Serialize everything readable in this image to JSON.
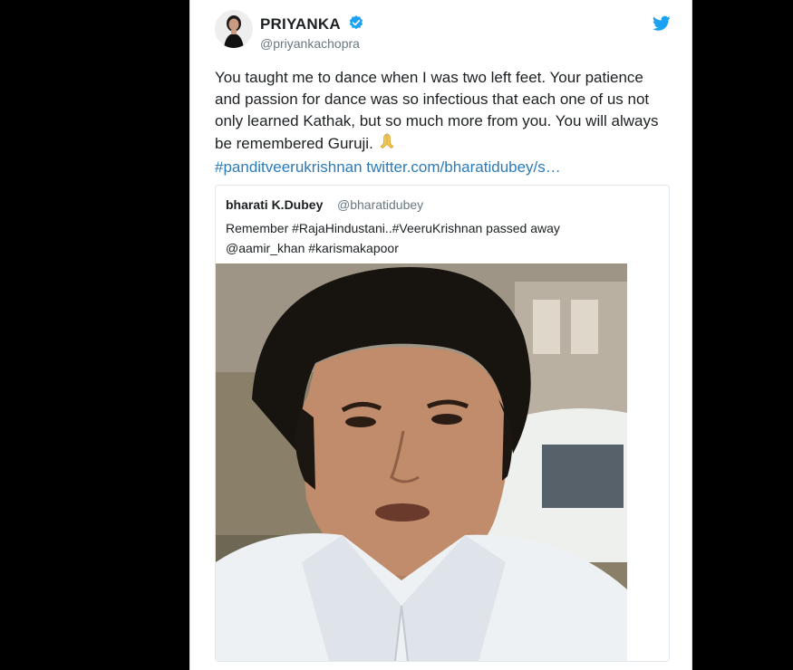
{
  "tweet": {
    "author_name": "PRIYANKA",
    "author_handle": "@priyankachopra",
    "text_main": "You taught me to dance when I was two left feet. Your patience and passion for dance was so infectious that each one of us not only learned Kathak, but so much more from you. You will always be remembered Guruji.",
    "hashtag": "#panditveerukrishnan",
    "link": "twitter.com/bharatidubey/s…",
    "emoji_icon": "folded-hands-icon",
    "icons": {
      "verified": "verified-badge-icon",
      "brand": "twitter-bird-icon"
    },
    "colors": {
      "link": "#2b7bb9",
      "verified": "#1da1f2",
      "text": "#1c2022",
      "muted": "#697882"
    }
  },
  "quoted_tweet": {
    "author_name": "bharati K.Dubey",
    "author_handle": "@bharatidubey",
    "line1": "Remember #RajaHindustani..#VeeruKrishnan passed away",
    "line2": "@aamir_khan #karismakapoor"
  }
}
